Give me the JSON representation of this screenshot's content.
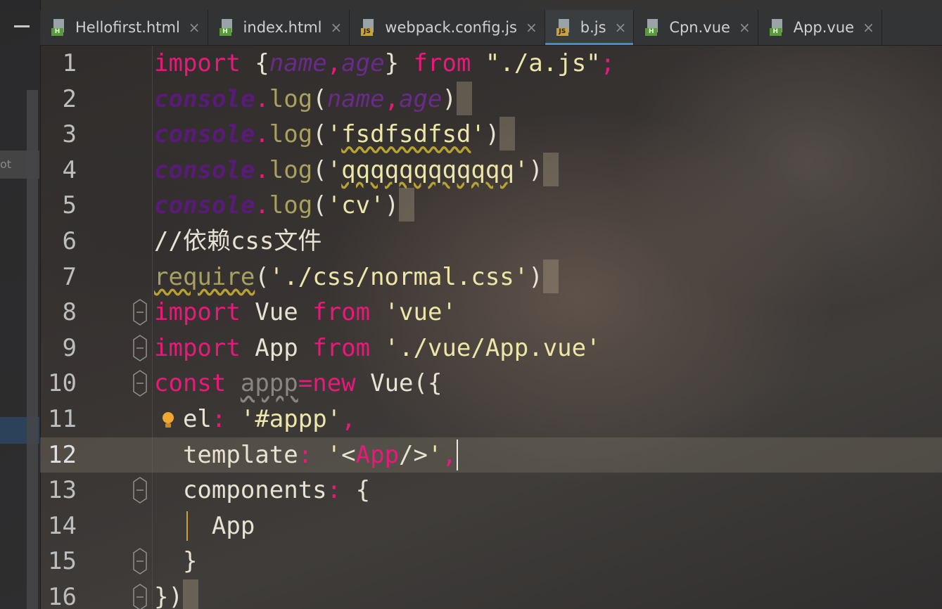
{
  "tabs": [
    {
      "label": "Hellofirst.html",
      "type": "html",
      "badge": "H",
      "active": false
    },
    {
      "label": "index.html",
      "type": "html",
      "badge": "H",
      "active": false
    },
    {
      "label": "webpack.config.js",
      "type": "js",
      "badge": "JS",
      "active": false
    },
    {
      "label": "b.js",
      "type": "js",
      "badge": "JS",
      "active": true
    },
    {
      "label": "Cpn.vue",
      "type": "html",
      "badge": "H",
      "active": false
    },
    {
      "label": "App.vue",
      "type": "html",
      "badge": "H",
      "active": false
    }
  ],
  "tab_close_glyph": "×",
  "sidebar": {
    "root_label": "ot"
  },
  "editor": {
    "current_line": 12,
    "lines": [
      {
        "n": "1",
        "tokens": [
          [
            "kw",
            "import"
          ],
          [
            "plain",
            " {"
          ],
          [
            "ital",
            "name"
          ],
          [
            "kw",
            ","
          ],
          [
            "ital",
            "age"
          ],
          [
            "plain",
            "} "
          ],
          [
            "kw",
            "from"
          ],
          [
            "str",
            " \"./a.js\""
          ],
          [
            "kw",
            ";"
          ]
        ]
      },
      {
        "n": "2",
        "tokens": [
          [
            "con",
            "console"
          ],
          [
            "kw",
            "."
          ],
          [
            "meth",
            "log"
          ],
          [
            "plain",
            "("
          ],
          [
            "ital",
            "name"
          ],
          [
            "kw",
            ","
          ],
          [
            "ital",
            "age"
          ],
          [
            "plain",
            ")"
          ]
        ],
        "block": true
      },
      {
        "n": "3",
        "tokens": [
          [
            "con",
            "console"
          ],
          [
            "kw",
            "."
          ],
          [
            "meth",
            "log"
          ],
          [
            "plain",
            "("
          ],
          [
            "str",
            "'"
          ],
          [
            "strw",
            "fsdfsdfsd"
          ],
          [
            "str",
            "'"
          ],
          [
            "plain",
            ")"
          ]
        ],
        "block": true
      },
      {
        "n": "4",
        "tokens": [
          [
            "con",
            "console"
          ],
          [
            "kw",
            "."
          ],
          [
            "meth",
            "log"
          ],
          [
            "plain",
            "("
          ],
          [
            "str",
            "'"
          ],
          [
            "strw",
            "qqqqqqqqqqqq"
          ],
          [
            "str",
            "'"
          ],
          [
            "plain",
            ")"
          ]
        ],
        "block": true
      },
      {
        "n": "5",
        "tokens": [
          [
            "con",
            "console"
          ],
          [
            "kw",
            "."
          ],
          [
            "meth",
            "log"
          ],
          [
            "plain",
            "("
          ],
          [
            "str",
            "'cv'"
          ],
          [
            "plain",
            ")"
          ]
        ],
        "block": true
      },
      {
        "n": "6",
        "tokens": [
          [
            "plain",
            "//依赖css文件"
          ]
        ]
      },
      {
        "n": "7",
        "tokens": [
          [
            "meth",
            "require"
          ],
          [
            "plain",
            "("
          ],
          [
            "str",
            "'./css/normal.css'"
          ],
          [
            "plain",
            ")"
          ]
        ],
        "block": true,
        "wavyFirst": true
      },
      {
        "n": "8",
        "tokens": [
          [
            "kw",
            "import"
          ],
          [
            "plain",
            " Vue "
          ],
          [
            "kw",
            "from"
          ],
          [
            "str",
            " 'vue'"
          ]
        ],
        "fold": true
      },
      {
        "n": "9",
        "tokens": [
          [
            "kw",
            "import"
          ],
          [
            "plain",
            " App "
          ],
          [
            "kw",
            "from"
          ],
          [
            "str",
            " './vue/App.vue'"
          ]
        ],
        "fold": true
      },
      {
        "n": "10",
        "tokens": [
          [
            "kw",
            "const"
          ],
          [
            "plain",
            " "
          ],
          [
            "dim",
            "appp"
          ],
          [
            "kw",
            "="
          ],
          [
            "kw",
            "new"
          ],
          [
            "plain",
            " Vue({"
          ]
        ],
        "fold": true
      },
      {
        "n": "11",
        "tokens": [
          [
            "plain",
            "  el"
          ],
          [
            "kw",
            ":"
          ],
          [
            "str",
            " '#appp'"
          ],
          [
            "kw",
            ","
          ]
        ],
        "bulb": true
      },
      {
        "n": "12",
        "tokens": [
          [
            "plain",
            "  template"
          ],
          [
            "kw",
            ":"
          ],
          [
            "str",
            " '"
          ],
          [
            "plain",
            "<"
          ],
          [
            "kw",
            "App"
          ],
          [
            "plain",
            "/>"
          ],
          [
            "str",
            "'"
          ],
          [
            "kw",
            ","
          ]
        ],
        "caret": true
      },
      {
        "n": "13",
        "tokens": [
          [
            "plain",
            "  components"
          ],
          [
            "kw",
            ":"
          ],
          [
            "plain",
            " {"
          ]
        ],
        "fold": true
      },
      {
        "n": "14",
        "tokens": [
          [
            "plain",
            "    App"
          ]
        ],
        "guide": true
      },
      {
        "n": "15",
        "tokens": [
          [
            "plain",
            "  }"
          ]
        ],
        "fold": true
      },
      {
        "n": "16",
        "tokens": [
          [
            "plain",
            "})"
          ]
        ],
        "fold": true,
        "block": true
      }
    ]
  },
  "colors": {
    "keyword": "#e8197a",
    "string": "#ece7a8",
    "console": "#5a1a7a",
    "method": "#a8a060",
    "text": "#e7e2d2",
    "tab_active_underline": "#4a88c7"
  }
}
